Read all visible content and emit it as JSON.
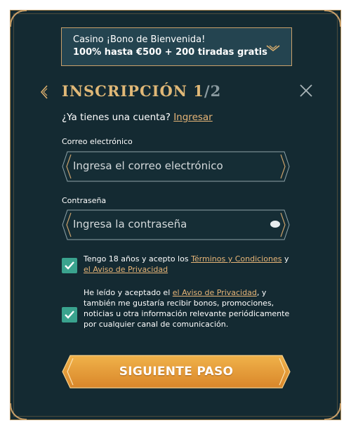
{
  "bonus": {
    "title": "Casino ¡Bono de Bienvenida!",
    "offer": "100% hasta €500 + 200 tiradas gratis",
    "icon": "chevron-down-icon"
  },
  "header": {
    "title": "INSCRIPCIÓN 1",
    "step_total": "/2",
    "back_icon": "chevron-left-icon",
    "close_icon": "close-icon"
  },
  "account": {
    "prompt": "¿Ya tienes una cuenta? ",
    "login_link": "Ingresar"
  },
  "email": {
    "label": "Correo electrónico",
    "placeholder": "Ingresa el correo electrónico",
    "value": ""
  },
  "password": {
    "label": "Contraseña",
    "placeholder": "Ingresa la contraseña",
    "value": "",
    "icon": "eye-icon"
  },
  "consent_terms": {
    "checked": true,
    "text_before": "Tengo 18 años y acepto los ",
    "link_terms": "Términos y Condiciones",
    "text_mid": " y ",
    "link_privacy": "el Aviso de Privacidad"
  },
  "consent_marketing": {
    "checked": true,
    "text_before": "He leído y aceptado el ",
    "link_privacy": "el Aviso de Privacidad",
    "text_after": ", y también me gustaría recibir bonos, promociones, noticias u otra información relevante periódicamente por cualquier canal de comunicación."
  },
  "cta": {
    "label": "SIGUIENTE PASO"
  },
  "colors": {
    "background": "#142a32",
    "gold": "#e0b877",
    "link": "#e7b577",
    "checkbox": "#3aa38e",
    "button": "#e19a33"
  }
}
